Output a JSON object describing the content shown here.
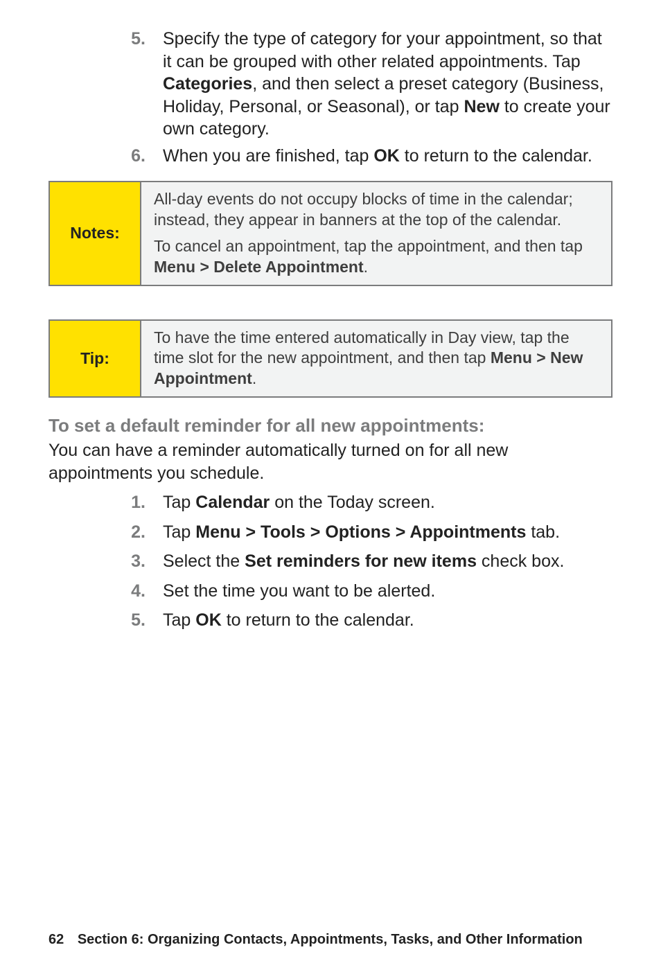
{
  "upperList": [
    {
      "num": "5.",
      "html": "Specify the type of category for your appointment, so that it can be grouped with other related appointments. Tap <b>Categories</b>, and then select a preset category (Business, Holiday, Personal, or Seasonal), or tap <b>New</b> to create your own category."
    },
    {
      "num": "6.",
      "html": "When you are finished, tap <b>OK</b> to return to the calendar."
    }
  ],
  "notesBox": {
    "label": "Notes:",
    "paras": [
      "All-day events do not occupy blocks of time in the calendar; instead, they appear in banners at the top of the calendar.",
      "To cancel an appointment, tap the appointment, and then tap <b>Menu > Delete Appointment</b>."
    ]
  },
  "tipBox": {
    "label": "Tip:",
    "paras": [
      "To have the time entered automatically in Day view, tap the time slot for the new appointment, and then tap <b>Menu > New Appointment</b>."
    ]
  },
  "subhead": "To set a default reminder for all new appointments:",
  "intro": "You can have a reminder automatically turned on for all new appointments you schedule.",
  "lowerList": [
    {
      "num": "1.",
      "html": "Tap <b>Calendar</b> on the Today screen."
    },
    {
      "num": "2.",
      "html": "Tap <b>Menu > Tools > Options > Appointments</b> tab."
    },
    {
      "num": "3.",
      "html": "Select the <b>Set reminders for new items</b> check box."
    },
    {
      "num": "4.",
      "html": "Set the time you want to be alerted."
    },
    {
      "num": "5.",
      "html": "Tap <b>OK</b> to return to the calendar."
    }
  ],
  "footer": {
    "pageNumber": "62",
    "sectionText": "Section 6: Organizing Contacts, Appointments, Tasks, and Other Information"
  }
}
